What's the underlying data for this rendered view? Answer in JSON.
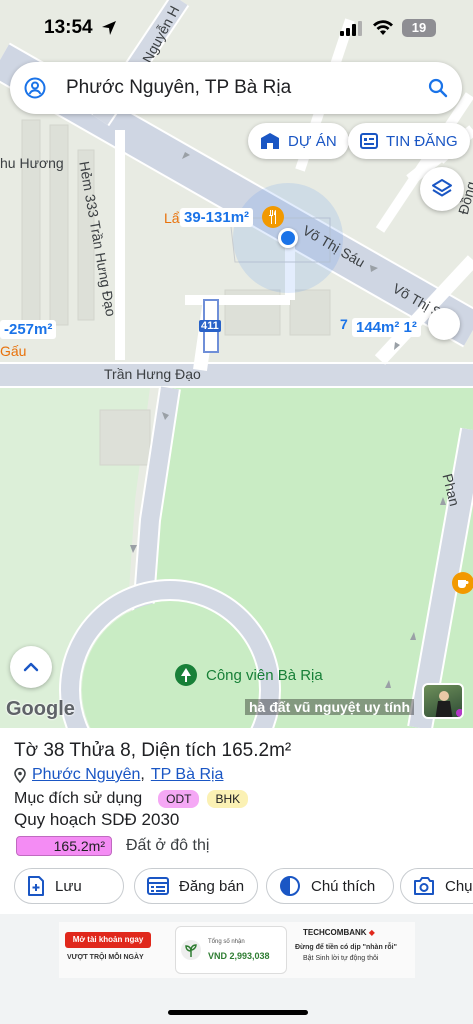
{
  "status_bar": {
    "time": "13:54",
    "battery": "19"
  },
  "search": {
    "text": "Phước Nguyên, TP Bà Rịa"
  },
  "chips": {
    "du_an": "DỰ ÁN",
    "tin_dang": "TIN ĐĂNG"
  },
  "map": {
    "roads": {
      "nguyen_top": "Nguyễn H",
      "hu_huong": "hu Hương",
      "hem_333": "Hẻm 333 Trần Hưng Đạo",
      "vo_thi_sau_1": "Võ Thị Sáu",
      "vo_thi_sau_2": "Võ Thị Sá",
      "dong": "Đồng",
      "tran_hung_dao": "Trần Hưng Đạo",
      "phan": "Phan",
      "gau": "Gấu",
      "lau": "Lẩ",
      "seven": "7"
    },
    "area_tags": {
      "a1": "39-131m²",
      "a2": "-257m²",
      "a3": "144m²",
      "a3_sup": "1²"
    },
    "highway_shield": "411",
    "park": "Công viên Bà Rịa",
    "google": "Google",
    "caption": "hà đất vũ nguyệt uy tính"
  },
  "sheet": {
    "title": "Tờ 38 Thửa 8, Diện tích 165.2m²",
    "ward": "Phước Nguyên",
    "separator": ",",
    "city": "TP Bà Rịa",
    "purpose_label": "Mục đích sử dụng",
    "badge_odt": "ODT",
    "badge_bhk": "BHK",
    "plan_label": "Quy hoạch SDĐ 2030",
    "plan_area": "165.2m²",
    "plan_type": "Đất ở đô thị",
    "actions": {
      "luu": "Lưu",
      "dang_ban": "Đăng bán",
      "chu_thich": "Chú thích",
      "chup": "Chụ"
    }
  },
  "ad": {
    "left_btn": "Mở tài khoản ngay",
    "left_sub": "VƯỢT TRỘI  MỖI NGÀY",
    "mid_label": "Tổng số nhận",
    "mid_value": "VND 2,993,038",
    "brand": "TECHCOMBANK",
    "right_line1": "Đừng để tiền có dịp \"nhàn rỗi\"",
    "right_line2": "Bật Sinh lời tự động thôi"
  },
  "colors": {
    "accent_blue": "#1a73e8",
    "park_green": "#c9ecc4",
    "badge_odt": "#f5a8f5",
    "badge_bhk": "#fbf1b4",
    "plan_pink": "#f48cf4",
    "progress_active": "#1a73e8",
    "progress_inactive": "#9aa0a6"
  }
}
